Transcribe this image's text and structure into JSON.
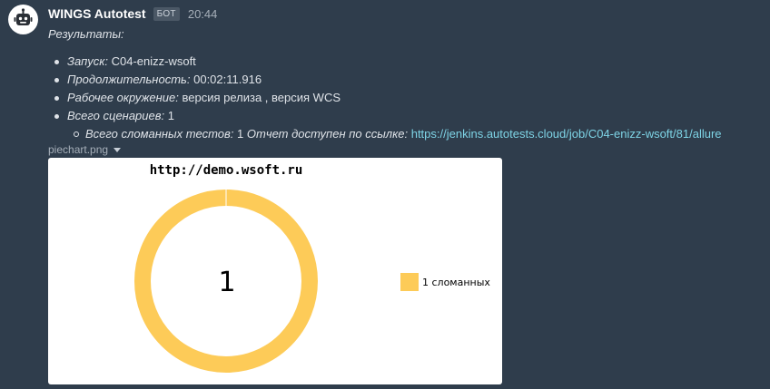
{
  "message": {
    "author": "WINGS Autotest",
    "badge": "БОТ",
    "time": "20:44",
    "avatar_icon": "robot-icon",
    "results_title": "Результаты:",
    "items": [
      {
        "label": "Запуск:",
        "value": "C04-enizz-wsoft"
      },
      {
        "label": "Продолжительность:",
        "value": "00:02:11.916"
      },
      {
        "label": "Рабочее окружение:",
        "value": "версия релиза , версия WCS"
      },
      {
        "label": "Всего сценариев:",
        "value": "1"
      }
    ],
    "sub_item": {
      "label": "Всего сломанных тестов:",
      "value": "1",
      "report_label": "Отчет доступен по ссылке:",
      "link": "https://jenkins.autotests.cloud/job/C04-enizz-wsoft/81/allure"
    },
    "attachment": {
      "filename": "piechart.png",
      "dropdown_icon": "caret-down-icon"
    }
  },
  "colors": {
    "background": "#2f3d4c",
    "link": "#7ed4e6",
    "slice_broken": "#fdcb58"
  },
  "chart_data": {
    "type": "pie",
    "title": "http://demo.wsoft.ru",
    "center_label": "1",
    "donut": true,
    "legend_position": "right",
    "slices": [
      {
        "name": "1 сломанных",
        "value": 1,
        "color": "#fdcb58"
      }
    ]
  }
}
